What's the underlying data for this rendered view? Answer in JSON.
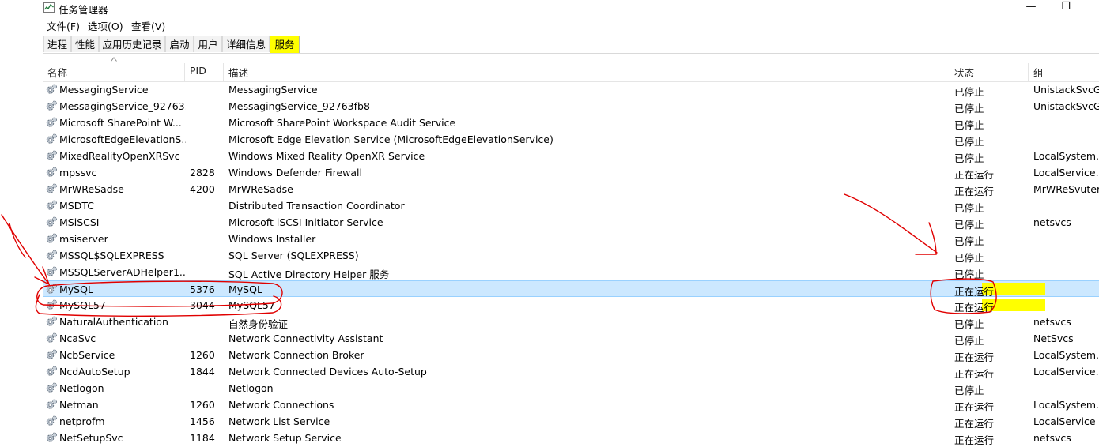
{
  "window": {
    "title": "任务管理器",
    "minimize": "—",
    "restore": "❐",
    "close": ""
  },
  "menu": [
    "文件(F)",
    "选项(O)",
    "查看(V)"
  ],
  "tabs": [
    "进程",
    "性能",
    "应用历史记录",
    "启动",
    "用户",
    "详细信息",
    "服务"
  ],
  "active_tab": "服务",
  "columns": {
    "name": "名称",
    "pid": "PID",
    "desc": "描述",
    "status": "状态",
    "group": "组"
  },
  "rows": [
    {
      "name": "MessagingService",
      "pid": "",
      "desc": "MessagingService",
      "status": "已停止",
      "group": "UnistackSvcG..."
    },
    {
      "name": "MessagingService_92763...",
      "pid": "",
      "desc": "MessagingService_92763fb8",
      "status": "已停止",
      "group": "UnistackSvcG..."
    },
    {
      "name": "Microsoft SharePoint W...",
      "pid": "",
      "desc": "Microsoft SharePoint Workspace Audit Service",
      "status": "已停止",
      "group": ""
    },
    {
      "name": "MicrosoftEdgeElevationS...",
      "pid": "",
      "desc": "Microsoft Edge Elevation Service (MicrosoftEdgeElevationService)",
      "status": "已停止",
      "group": ""
    },
    {
      "name": "MixedRealityOpenXRSvc",
      "pid": "",
      "desc": "Windows Mixed Reality OpenXR Service",
      "status": "已停止",
      "group": "LocalSystem..."
    },
    {
      "name": "mpssvc",
      "pid": "2828",
      "desc": "Windows Defender Firewall",
      "status": "正在运行",
      "group": "LocalService..."
    },
    {
      "name": "MrWReSadse",
      "pid": "4200",
      "desc": "MrWReSadse",
      "status": "正在运行",
      "group": "MrWReSvuter"
    },
    {
      "name": "MSDTC",
      "pid": "",
      "desc": "Distributed Transaction Coordinator",
      "status": "已停止",
      "group": ""
    },
    {
      "name": "MSiSCSI",
      "pid": "",
      "desc": "Microsoft iSCSI Initiator Service",
      "status": "已停止",
      "group": "netsvcs"
    },
    {
      "name": "msiserver",
      "pid": "",
      "desc": "Windows Installer",
      "status": "已停止",
      "group": ""
    },
    {
      "name": "MSSQL$SQLEXPRESS",
      "pid": "",
      "desc": "SQL Server (SQLEXPRESS)",
      "status": "已停止",
      "group": ""
    },
    {
      "name": "MSSQLServerADHelper1...",
      "pid": "",
      "desc": "SQL Active Directory Helper 服务",
      "status": "已停止",
      "group": ""
    },
    {
      "name": "MySQL",
      "pid": "5376",
      "desc": "MySQL",
      "status": "正在运行",
      "group": ""
    },
    {
      "name": "MySQL57",
      "pid": "3044",
      "desc": "MySQL57",
      "status": "正在运行",
      "group": ""
    },
    {
      "name": "NaturalAuthentication",
      "pid": "",
      "desc": "自然身份验证",
      "status": "已停止",
      "group": "netsvcs"
    },
    {
      "name": "NcaSvc",
      "pid": "",
      "desc": "Network Connectivity Assistant",
      "status": "已停止",
      "group": "NetSvcs"
    },
    {
      "name": "NcbService",
      "pid": "1260",
      "desc": "Network Connection Broker",
      "status": "正在运行",
      "group": "LocalSystem..."
    },
    {
      "name": "NcdAutoSetup",
      "pid": "1844",
      "desc": "Network Connected Devices Auto-Setup",
      "status": "正在运行",
      "group": "LocalService..."
    },
    {
      "name": "Netlogon",
      "pid": "",
      "desc": "Netlogon",
      "status": "已停止",
      "group": ""
    },
    {
      "name": "Netman",
      "pid": "1260",
      "desc": "Network Connections",
      "status": "正在运行",
      "group": "LocalSystem..."
    },
    {
      "name": "netprofm",
      "pid": "1456",
      "desc": "Network List Service",
      "status": "正在运行",
      "group": "LocalService"
    },
    {
      "name": "NetSetupSvc",
      "pid": "1184",
      "desc": "Network Setup Service",
      "status": "正在运行",
      "group": "netsvcs"
    }
  ],
  "selected_service": "MySQL",
  "highlighted_services": [
    "MySQL",
    "MySQL57"
  ],
  "colors": {
    "highlight": "#ffff00",
    "annotation": "#e00000",
    "selection": "#cce8ff"
  }
}
